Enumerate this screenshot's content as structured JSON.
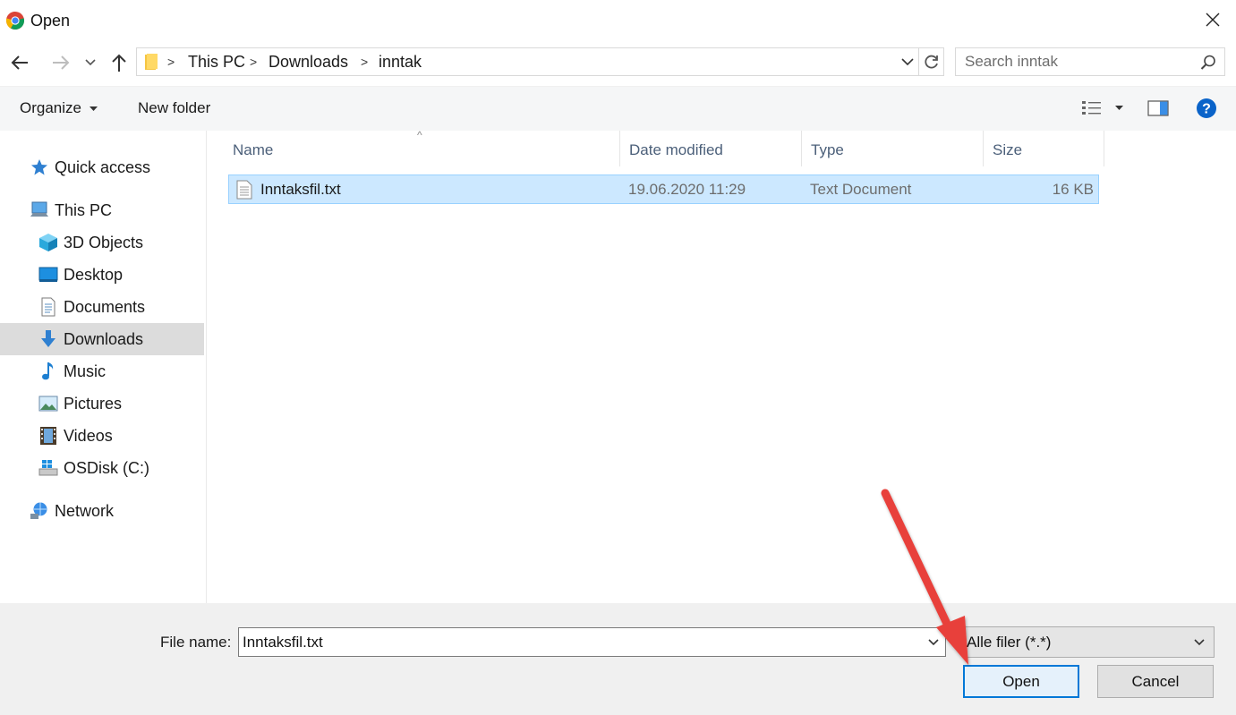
{
  "window": {
    "title": "Open",
    "app_icon": "chrome-icon"
  },
  "nav": {
    "back_icon": "back-arrow-icon",
    "forward_icon": "forward-arrow-icon",
    "recent_icon": "chevron-down-icon",
    "up_icon": "up-arrow-icon",
    "breadcrumb": [
      "This PC",
      "Downloads",
      "inntak"
    ],
    "search_placeholder": "Search inntak"
  },
  "toolbar": {
    "organize_label": "Organize",
    "new_folder_label": "New folder",
    "view_icon": "details-view-icon",
    "preview_icon": "preview-pane-icon",
    "help_icon": "help-icon"
  },
  "sidebar": {
    "items": [
      {
        "label": "Quick access",
        "icon": "star-icon"
      },
      {
        "label": "This PC",
        "icon": "computer-icon"
      },
      {
        "label": "3D Objects",
        "icon": "cube-icon"
      },
      {
        "label": "Desktop",
        "icon": "desktop-icon"
      },
      {
        "label": "Documents",
        "icon": "document-icon"
      },
      {
        "label": "Downloads",
        "icon": "download-icon",
        "selected": true
      },
      {
        "label": "Music",
        "icon": "music-icon"
      },
      {
        "label": "Pictures",
        "icon": "picture-icon"
      },
      {
        "label": "Videos",
        "icon": "video-icon"
      },
      {
        "label": "OSDisk (C:)",
        "icon": "drive-icon"
      },
      {
        "label": "Network",
        "icon": "network-icon"
      }
    ]
  },
  "file_list": {
    "columns": [
      "Name",
      "Date modified",
      "Type",
      "Size"
    ],
    "rows": [
      {
        "name": "Inntaksfil.txt",
        "date_modified": "19.06.2020 11:29",
        "type": "Text Document",
        "size": "16 KB",
        "icon": "text-file-icon",
        "selected": true
      }
    ]
  },
  "footer": {
    "file_name_label": "File name:",
    "file_name_value": "Inntaksfil.txt",
    "filter_value": "Alle filer (*.*)",
    "open_label": "Open",
    "cancel_label": "Cancel"
  },
  "annotation": {
    "arrow_color": "#e8403a"
  }
}
